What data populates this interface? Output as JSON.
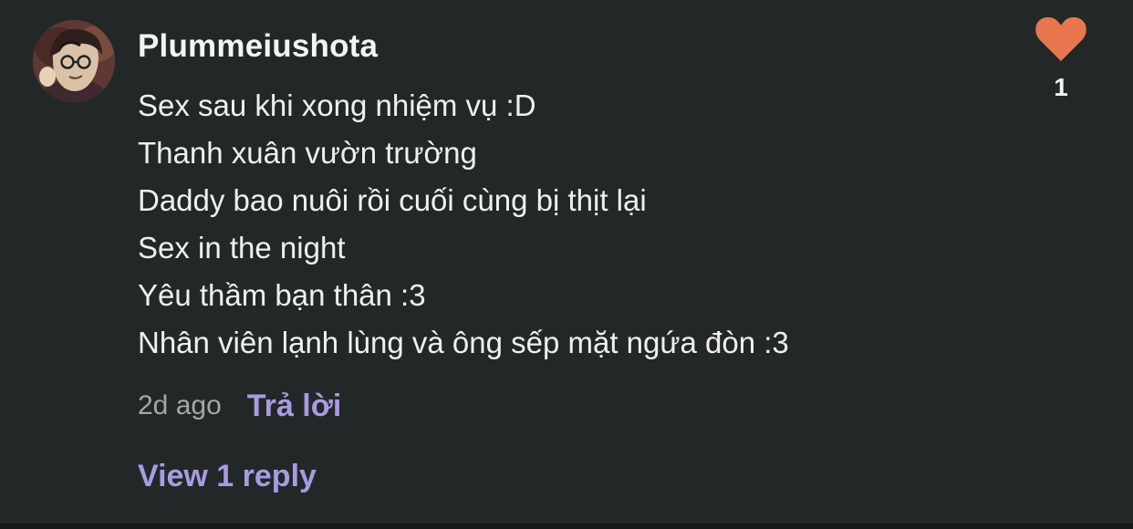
{
  "comment": {
    "username": "Plummeiushota",
    "lines": [
      "Sex sau khi xong nhiệm vụ :D",
      "Thanh xuân vườn trường",
      "Daddy bao nuôi rồi cuối cùng bị thịt lại",
      "Sex in the night",
      "Yêu thầm bạn thân :3",
      "Nhân viên lạnh lùng và ông sếp mặt ngứa đòn :3"
    ],
    "timestamp": "2d ago",
    "reply_label": "Trả lời",
    "view_replies_label": "View 1 reply",
    "like_count": "1",
    "avatar_icon": "user-avatar",
    "like_icon": "heart-icon"
  },
  "colors": {
    "background": "#222828",
    "accent": "#a99be0",
    "heart": "#e8764f"
  }
}
